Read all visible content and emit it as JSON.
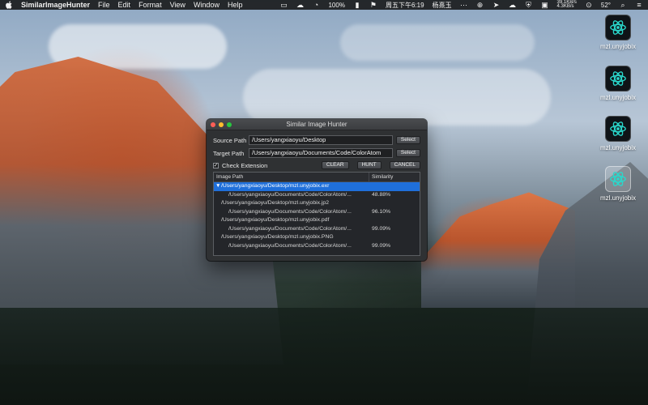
{
  "menubar": {
    "left": [
      "SimilarImageHunter",
      "File",
      "Edit",
      "Format",
      "View",
      "Window",
      "Help"
    ],
    "battery": "100%",
    "datetime": "周五下午6:19",
    "user": "杨熹玉",
    "net_up": "39.1KB/s",
    "net_down": "4.3KB/s",
    "temperature": "52°"
  },
  "desktop_icons": [
    {
      "label": "mzl.unyjobix",
      "selected": false
    },
    {
      "label": "mzl.unyjobix",
      "selected": false
    },
    {
      "label": "mzl.unyjobix",
      "selected": false
    },
    {
      "label": "mzl.unyjobix",
      "selected": true
    }
  ],
  "window": {
    "title": "Similar Image Hunter",
    "source_label": "Source Path",
    "source_path": "/Users/yangxiaoyu/Desktop",
    "source_select": "Select",
    "target_label": "Target Path",
    "target_path": "/Users/yangxiaoyu/Documents/Code/ColorAtom",
    "target_select": "Select",
    "check_label": "Check Extension",
    "check_checked": true,
    "clear_label": "CLEAR",
    "hunt_label": "HUNT",
    "cancel_label": "CANCEL",
    "table": {
      "col_path": "Image Path",
      "col_similarity": "Similarity",
      "rows": [
        {
          "path": "/Users/yangxiaoyu/Desktop/mzl.unyjobix.exr",
          "similarity": "",
          "level": 0,
          "selected": true,
          "expanded": true
        },
        {
          "path": "/Users/yangxiaoyu/Documents/Code/ColorAtom/...",
          "similarity": "48.88%",
          "level": 1,
          "selected": false
        },
        {
          "path": "/Users/yangxiaoyu/Desktop/mzl.unyjobix.jp2",
          "similarity": "",
          "level": 0,
          "selected": false
        },
        {
          "path": "/Users/yangxiaoyu/Documents/Code/ColorAtom/...",
          "similarity": "96.10%",
          "level": 1,
          "selected": false
        },
        {
          "path": "/Users/yangxiaoyu/Desktop/mzl.unyjobix.pdf",
          "similarity": "",
          "level": 0,
          "selected": false
        },
        {
          "path": "/Users/yangxiaoyu/Documents/Code/ColorAtom/...",
          "similarity": "99.09%",
          "level": 1,
          "selected": false
        },
        {
          "path": "/Users/yangxiaoyu/Desktop/mzl.unyjobix.PNG",
          "similarity": "",
          "level": 0,
          "selected": false
        },
        {
          "path": "/Users/yangxiaoyu/Documents/Code/ColorAtom/...",
          "similarity": "99.09%",
          "level": 1,
          "selected": false
        }
      ]
    }
  }
}
